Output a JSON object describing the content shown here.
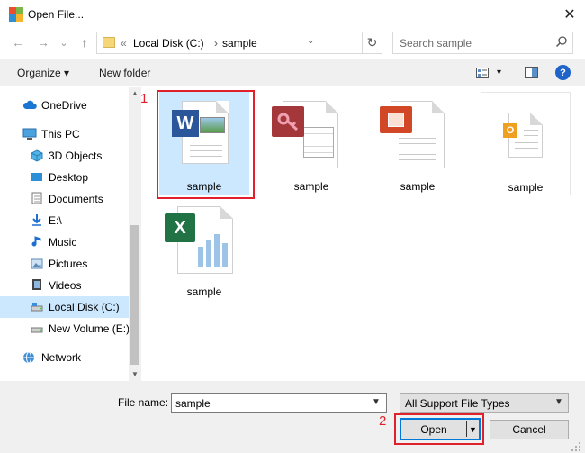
{
  "window": {
    "title": "Open File...",
    "close": "✕"
  },
  "nav": {
    "back": "←",
    "forward": "→",
    "recent": "⌄",
    "up": "↑"
  },
  "address": {
    "overflow": "«",
    "crumbs": [
      "Local Disk (C:)",
      "sample"
    ],
    "separator": "›",
    "dropdown": "⌄",
    "refresh": "↻"
  },
  "search": {
    "placeholder": "Search sample"
  },
  "toolbar": {
    "organize": "Organize ▾",
    "new_folder": "New folder",
    "view_dropdown": "▾",
    "help": "?"
  },
  "sidebar": {
    "items": [
      {
        "label": "OneDrive",
        "icon": "cloud-icon"
      },
      {
        "label": "This PC",
        "icon": "computer-icon"
      },
      {
        "label": "3D Objects",
        "icon": "cube-icon"
      },
      {
        "label": "Desktop",
        "icon": "desktop-icon"
      },
      {
        "label": "Documents",
        "icon": "document-icon"
      },
      {
        "label": "E:\\",
        "icon": "download-drive-icon"
      },
      {
        "label": "Music",
        "icon": "music-icon"
      },
      {
        "label": "Pictures",
        "icon": "picture-icon"
      },
      {
        "label": "Videos",
        "icon": "video-icon"
      },
      {
        "label": "Local Disk (C:)",
        "icon": "drive-icon",
        "selected": true
      },
      {
        "label": "New Volume (E:)",
        "icon": "drive-icon"
      },
      {
        "label": "Network",
        "icon": "network-icon"
      }
    ]
  },
  "files": [
    {
      "label": "sample",
      "type": "word",
      "selected": true
    },
    {
      "label": "sample",
      "type": "access"
    },
    {
      "label": "sample",
      "type": "powerpoint"
    },
    {
      "label": "sample",
      "type": "outlook"
    },
    {
      "label": "sample",
      "type": "excel"
    }
  ],
  "annotations": {
    "one": "1",
    "two": "2"
  },
  "bottom": {
    "filename_label": "File name:",
    "filename_value": "sample",
    "filetype_value": "All Support File Types",
    "open_label": "Open",
    "cancel_label": "Cancel"
  },
  "colors": {
    "accent": "#0078d7",
    "selection": "#cce8ff",
    "annotation": "#e0202a"
  }
}
